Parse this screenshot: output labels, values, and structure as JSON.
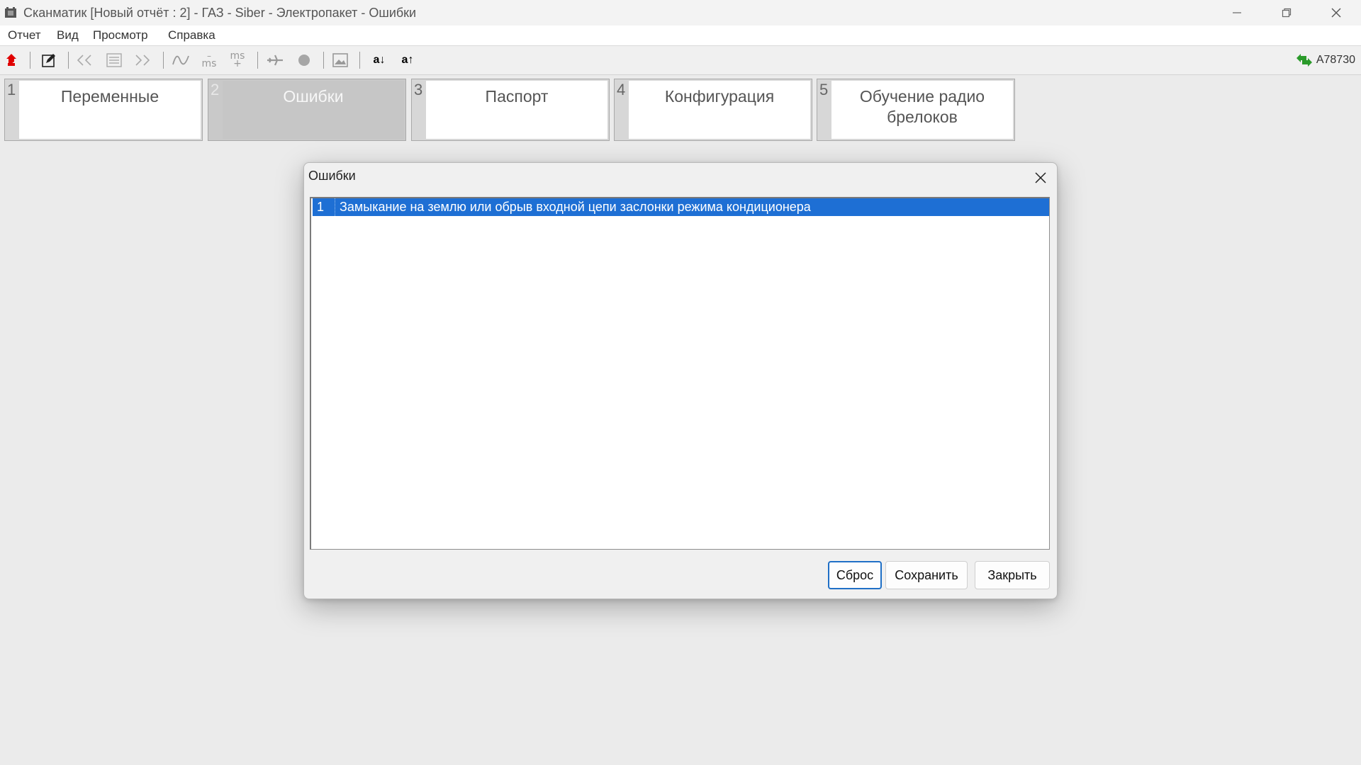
{
  "window": {
    "title": "Сканматик [Новый отчёт : 2] - ГАЗ - Siber - Электропакет - Ошибки",
    "icon": "app-icon"
  },
  "menu": {
    "items": [
      "Отчет",
      "Вид",
      "Просмотр",
      "Справка"
    ]
  },
  "toolbar": {
    "connection_label": "A78730",
    "font_down_label": "a↓",
    "font_up_label": "a↑",
    "ms_minus_label": "ms",
    "ms_plus_label": "ms"
  },
  "tabs": [
    {
      "num": "1",
      "label": "Переменные",
      "active": false
    },
    {
      "num": "2",
      "label": "Ошибки",
      "active": true
    },
    {
      "num": "3",
      "label": "Паспорт",
      "active": false
    },
    {
      "num": "4",
      "label": "Конфигурация",
      "active": false
    },
    {
      "num": "5",
      "label": "Обучение радио брелоков",
      "active": false
    }
  ],
  "dialog": {
    "title": "Ошибки",
    "errors": [
      {
        "num": "1",
        "text": "Замыкание на землю или обрыв входной цепи заслонки режима кондиционера",
        "selected": true
      }
    ],
    "buttons": {
      "reset": "Сброс",
      "save": "Сохранить",
      "close": "Закрыть"
    }
  },
  "colors": {
    "selection": "#1e6fd4",
    "primary_button_border": "#1f6fc6",
    "up_arrow": "#e00000",
    "connection_icon": "#2a9a2a"
  }
}
